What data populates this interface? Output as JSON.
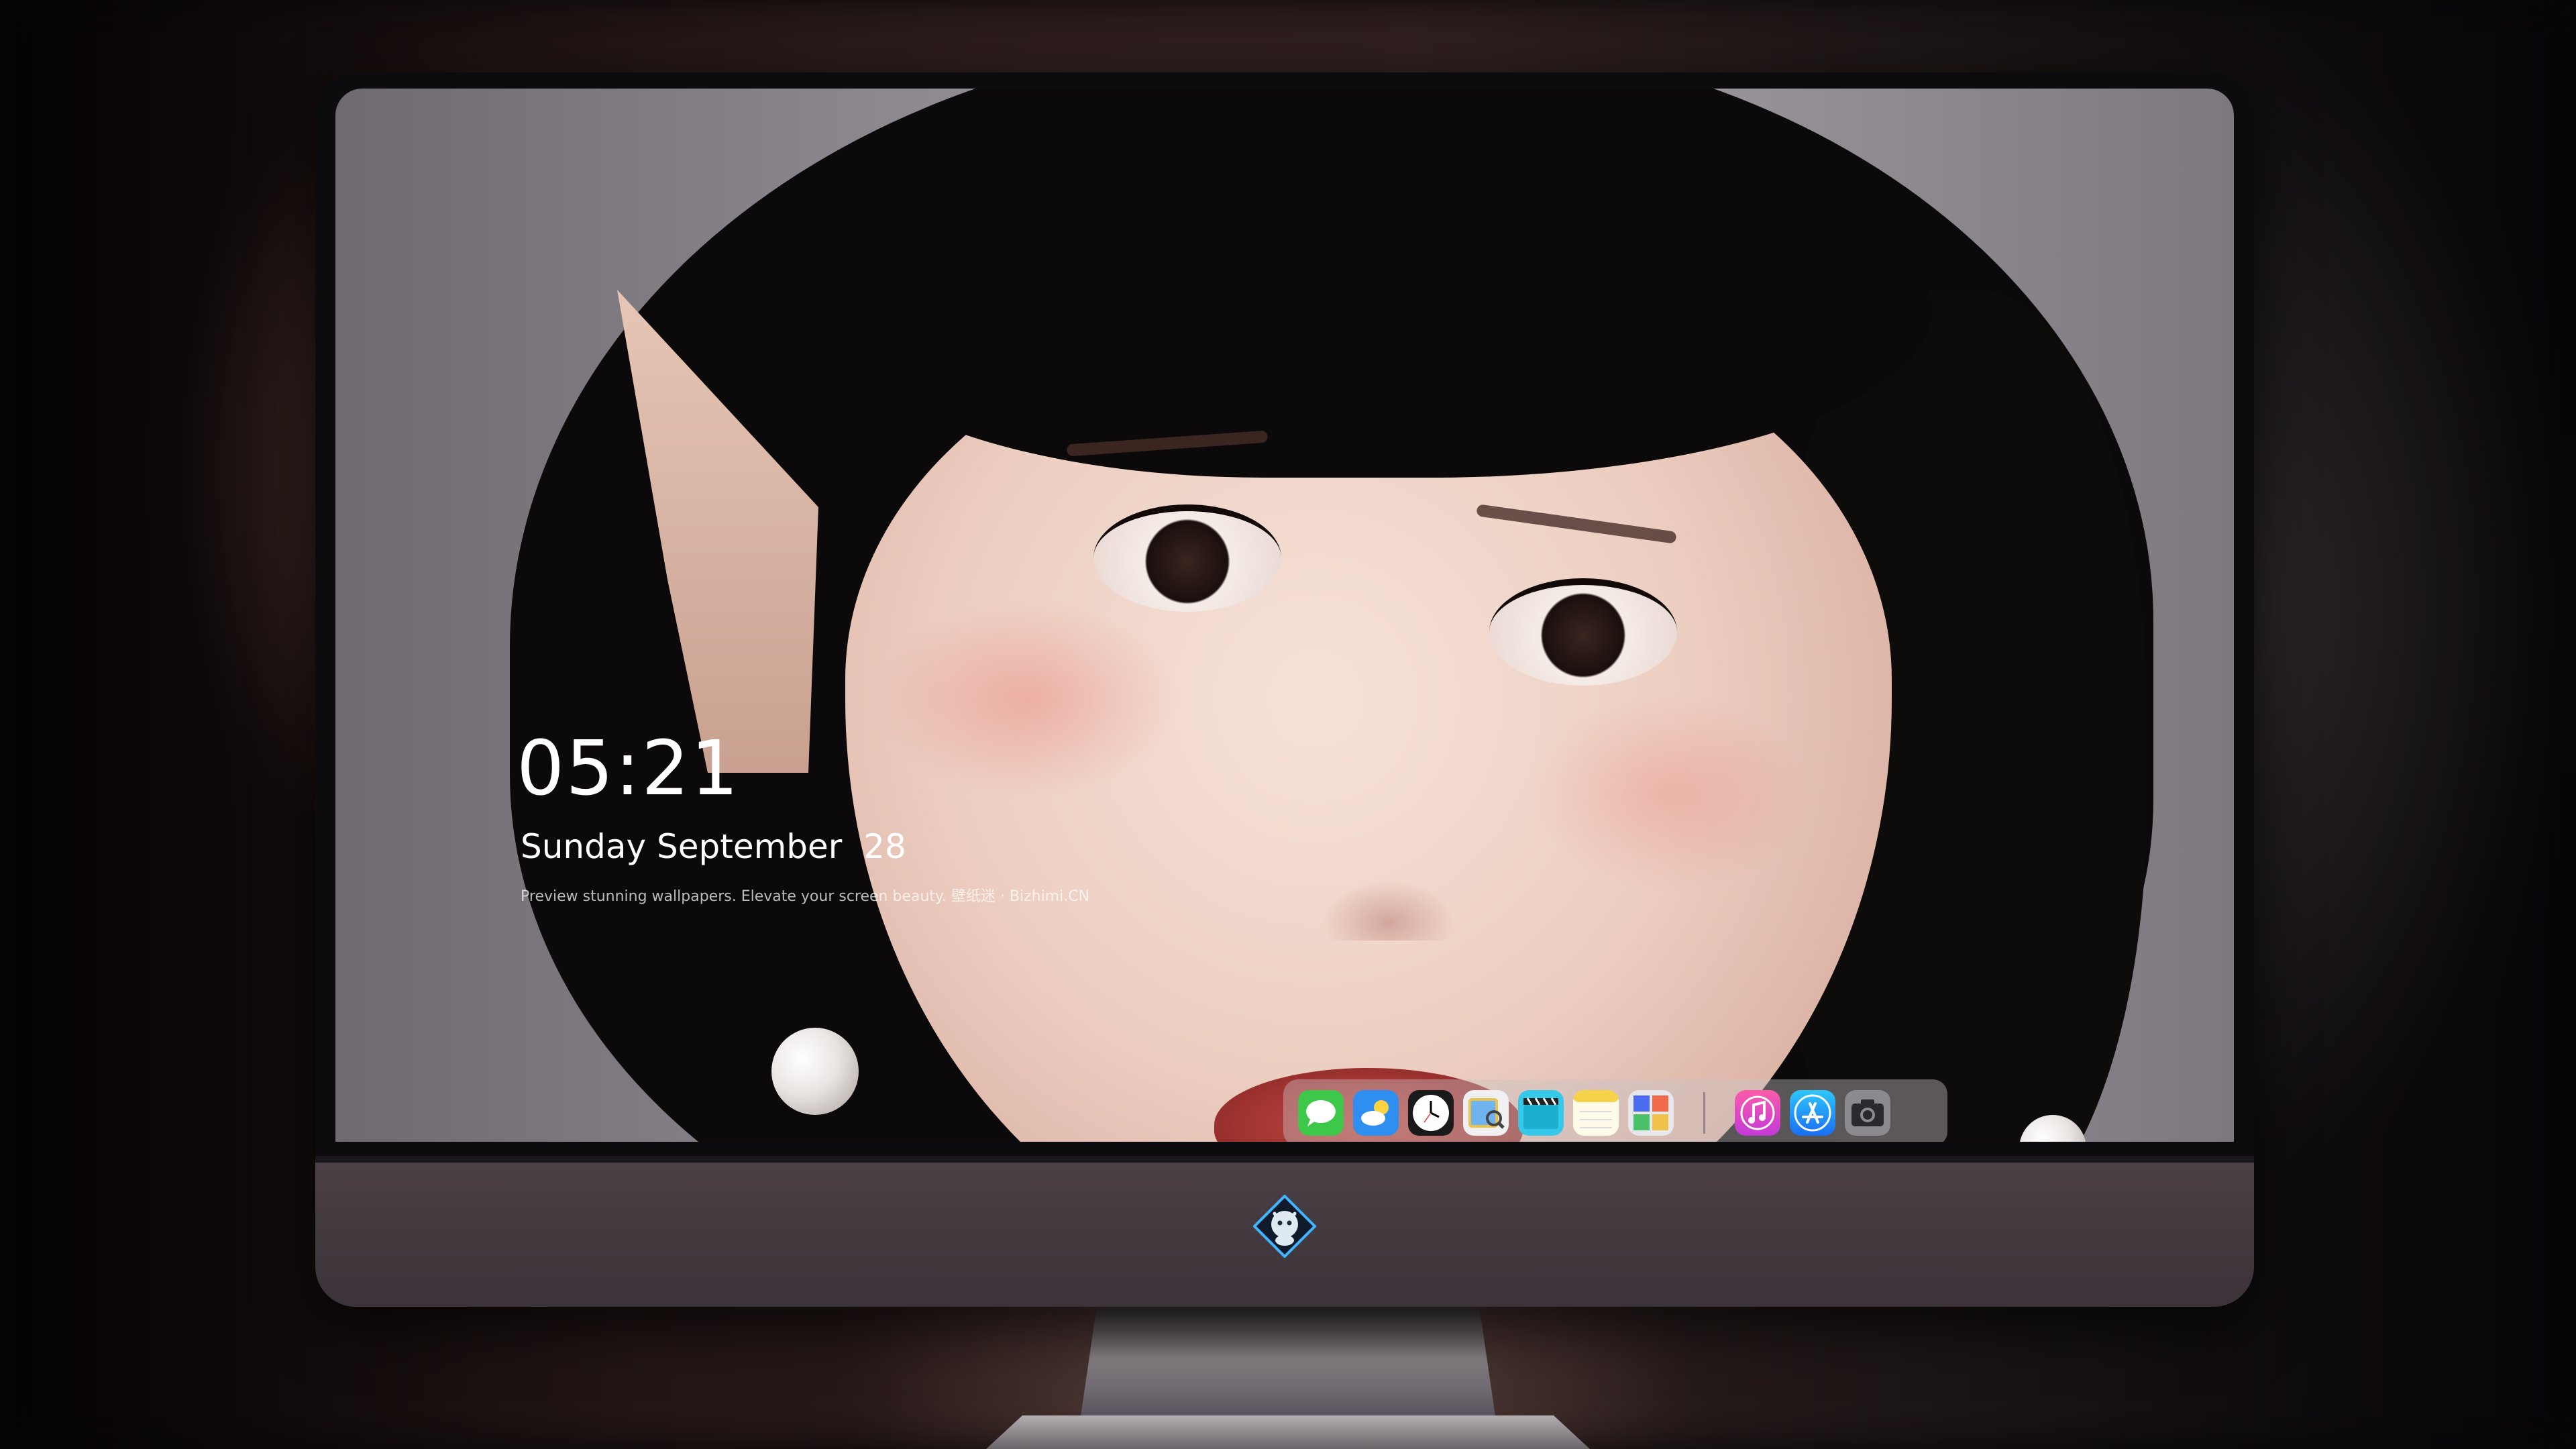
{
  "lock_screen": {
    "time": "05:21",
    "date": "Sunday September  28",
    "caption": "Preview stunning wallpapers. Elevate your screen beauty. 壁纸迷 · Bizhimi.CN"
  },
  "dock": {
    "apps": [
      {
        "name": "messages-icon",
        "color": "#3ec84a"
      },
      {
        "name": "weather-icon",
        "color": "#2f8ff0"
      },
      {
        "name": "clock-icon",
        "color": "#ffffff"
      },
      {
        "name": "preview-icon",
        "color": "#e8c24a"
      },
      {
        "name": "clips-icon",
        "color": "#35c8e8"
      },
      {
        "name": "notes-icon",
        "color": "#f6d24a"
      },
      {
        "name": "photo-booth-icon",
        "color": "#4a6cf0"
      },
      {
        "name": "music-icon",
        "color": "#e8459a"
      },
      {
        "name": "app-store-icon",
        "color": "#1e8ff5"
      },
      {
        "name": "screenshot-icon",
        "color": "#8a8a8f"
      }
    ]
  },
  "monitor": {
    "logo": "dragon-logo-icon"
  }
}
